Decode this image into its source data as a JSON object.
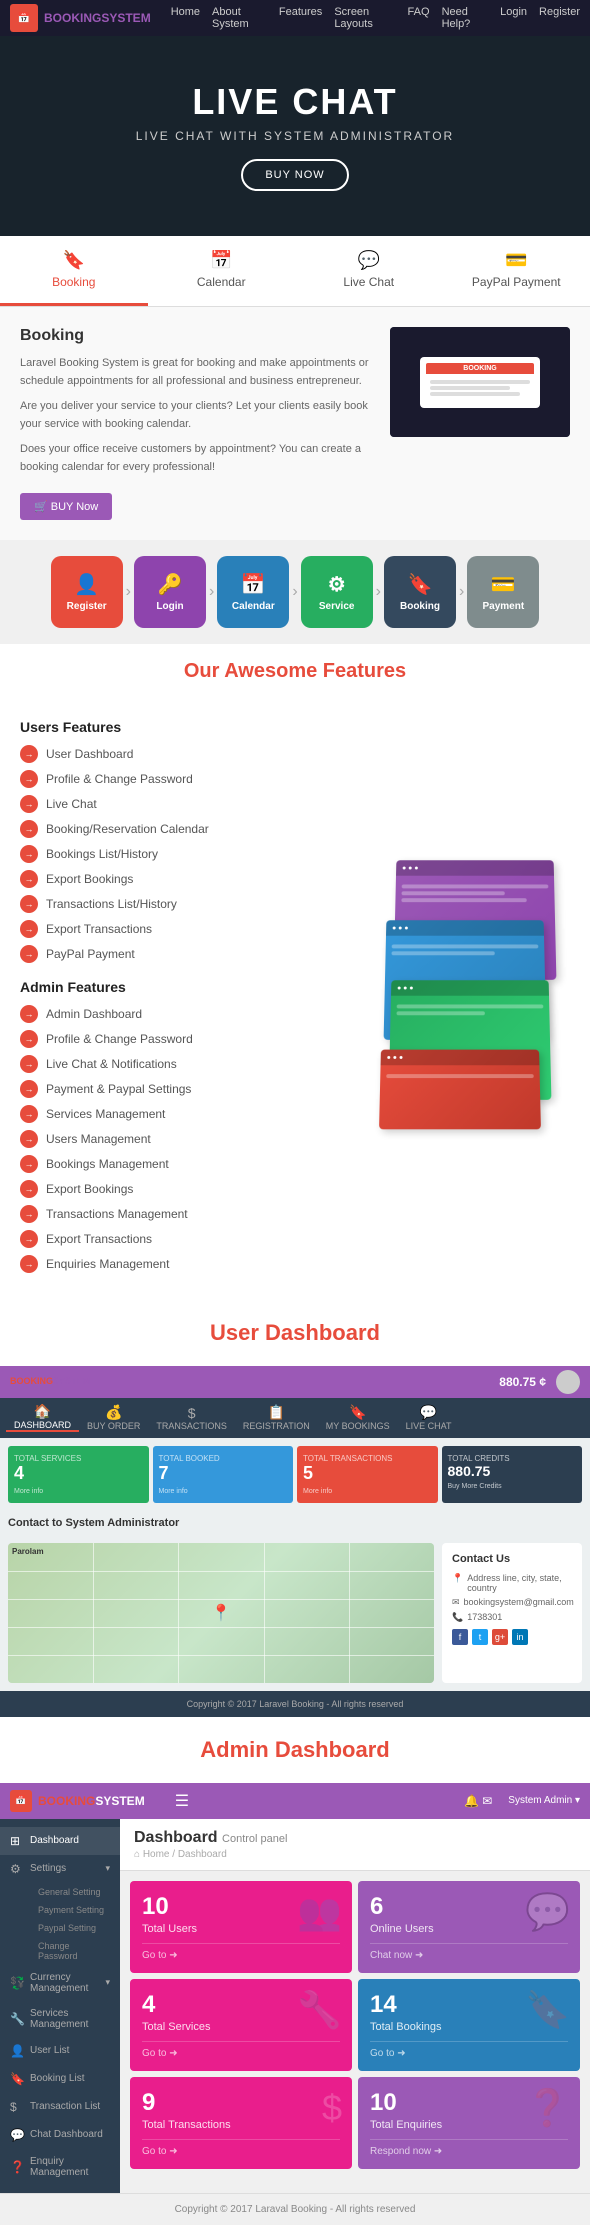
{
  "nav": {
    "logo_icon": "BS",
    "logo_text_1": "BOOKING",
    "logo_text_2": "SYSTEM",
    "links": [
      "Home",
      "About System",
      "Features",
      "Screen Layouts",
      "FAQ",
      "Need Help?",
      "Login",
      "Register"
    ]
  },
  "hero": {
    "title": "LIVE CHAT",
    "subtitle": "LIVE CHAT WITH SYSTEM ADMINISTRATOR",
    "button": "BUY NOW"
  },
  "tabs": [
    {
      "icon": "🔖",
      "label": "Booking",
      "active": true
    },
    {
      "icon": "📅",
      "label": "Calendar",
      "active": false
    },
    {
      "icon": "💬",
      "label": "Live Chat",
      "active": false
    },
    {
      "icon": "💳",
      "label": "PayPal Payment",
      "active": false
    }
  ],
  "booking": {
    "title": "Booking",
    "text1": "Laravel Booking System is great for booking and make appointments or schedule appointments for all professional and business entrepreneur.",
    "text2": "Are you deliver your service to your clients? Let your clients easily book your service with booking calendar.",
    "text3": "Does your office receive customers by appointment? You can create a booking calendar for every professional!",
    "button": "🛒 BUY Now",
    "screen_label": "BOOKING"
  },
  "workflow": {
    "steps": [
      {
        "icon": "👤",
        "label": "Register",
        "color": "wf-red"
      },
      {
        "icon": "🔑",
        "label": "Login",
        "color": "wf-purple"
      },
      {
        "icon": "📅",
        "label": "Calendar",
        "color": "wf-blue"
      },
      {
        "icon": "⚙",
        "label": "Service",
        "color": "wf-green"
      },
      {
        "icon": "🔖",
        "label": "Booking",
        "color": "wf-darkblue"
      },
      {
        "icon": "💳",
        "label": "Payment",
        "color": "wf-gray"
      }
    ]
  },
  "awesome": {
    "title": "Our Awesome Features",
    "users_title": "Users Features",
    "user_items": [
      "User Dashboard",
      "Profile & Change Password",
      "Live Chat",
      "Booking/Reservation Calendar",
      "Bookings List/History",
      "Export Bookings",
      "Transactions List/History",
      "Export Transactions",
      "PayPal Payment"
    ],
    "admin_title": "Admin Features",
    "admin_items": [
      "Admin Dashboard",
      "Profile & Change Password",
      "Live Chat & Notifications",
      "Payment & Paypal Settings",
      "Services Management",
      "Users Management",
      "Bookings Management",
      "Export Bookings",
      "Transactions Management",
      "Export Transactions",
      "Enquiries Management"
    ]
  },
  "user_dashboard": {
    "section_title": "User Dashboard",
    "logo": "BOOKING SYSTEM",
    "amount": "880.75 ¢",
    "subnav": [
      {
        "icon": "🏠",
        "label": "DASHBOARD",
        "active": true
      },
      {
        "icon": "💰",
        "label": "BUY ORDER"
      },
      {
        "icon": "$",
        "label": "TRANSACTIONS"
      },
      {
        "icon": "📋",
        "label": "REGISTRATION"
      },
      {
        "icon": "🔖",
        "label": "MY BOOKINGS"
      },
      {
        "icon": "💬",
        "label": "LIVE CHAT"
      }
    ],
    "stats": [
      {
        "label": "TOTAL SERVICES",
        "value": "4",
        "sub": "",
        "more": "More info",
        "color": "ds-green"
      },
      {
        "label": "TOTAL BOOKED",
        "value": "7",
        "sub": "",
        "more": "More info",
        "color": "ds-blue"
      },
      {
        "label": "TOTAL TRANSACTIONS",
        "value": "5",
        "sub": "",
        "more": "More info",
        "color": "ds-red"
      },
      {
        "label": "TOTAL CREDITS",
        "value": "880.75",
        "sub": "",
        "more": "Buy More Credits",
        "color": "ds-dark"
      }
    ],
    "contact_section": "Contact to System Administrator",
    "address_title": "Contact Us",
    "address": "Address line, city, state, country",
    "email": "bookingsystem@gmail.com",
    "phone": "1738301",
    "footer": "Copyright © 2017 Laravel Booking - All rights reserved"
  },
  "admin_dashboard": {
    "section_title": "Admin Dashboard",
    "logo": "BOOKING SYSTEM",
    "menu_icon": "☰",
    "user": "System Admin ▾",
    "main_title": "Dashboard",
    "sub_title": "Control panel",
    "breadcrumb": "⌂ Home / Dashboard",
    "sidebar_items": [
      {
        "icon": "⊞",
        "label": "Dashboard",
        "active": true
      },
      {
        "icon": "⚙",
        "label": "Settings",
        "has_sub": true
      },
      {
        "icon": "",
        "label": "General Setting",
        "sub": true
      },
      {
        "icon": "",
        "label": "Payment Setting",
        "sub": true
      },
      {
        "icon": "",
        "label": "Paypal Setting",
        "sub": true
      },
      {
        "icon": "",
        "label": "Change Password",
        "sub": true
      },
      {
        "icon": "💱",
        "label": "Currency Management",
        "has_sub": true
      },
      {
        "icon": "🔧",
        "label": "Services Management"
      },
      {
        "icon": "👤",
        "label": "User List"
      },
      {
        "icon": "🔖",
        "label": "Booking List"
      },
      {
        "icon": "$",
        "label": "Transaction List"
      },
      {
        "icon": "💬",
        "label": "Chat Dashboard"
      },
      {
        "icon": "❓",
        "label": "Enquiry Management"
      }
    ],
    "stats": [
      {
        "num": "10",
        "label": "Total Users",
        "link": "Go to ➜",
        "color": "as-magenta",
        "icon": "👥"
      },
      {
        "num": "6",
        "label": "Online Users",
        "link": "Chat now ➜",
        "color": "as-purple",
        "icon": "💬"
      },
      {
        "num": "4",
        "label": "Total Services",
        "link": "Go to ➜",
        "color": "as-magenta",
        "icon": "🔧"
      },
      {
        "num": "14",
        "label": "Total Bookings",
        "link": "Go to ➜",
        "color": "as-blue",
        "icon": "🔖"
      },
      {
        "num": "9",
        "label": "Total Transactions",
        "link": "Go to ➜",
        "color": "as-pink",
        "icon": "$"
      },
      {
        "num": "10",
        "label": "Total Enquiries",
        "link": "Respond now ➜",
        "color": "as-purple",
        "icon": "❓"
      }
    ],
    "footer": "Copyright © 2017 Laraval Booking - All rights reserved"
  }
}
